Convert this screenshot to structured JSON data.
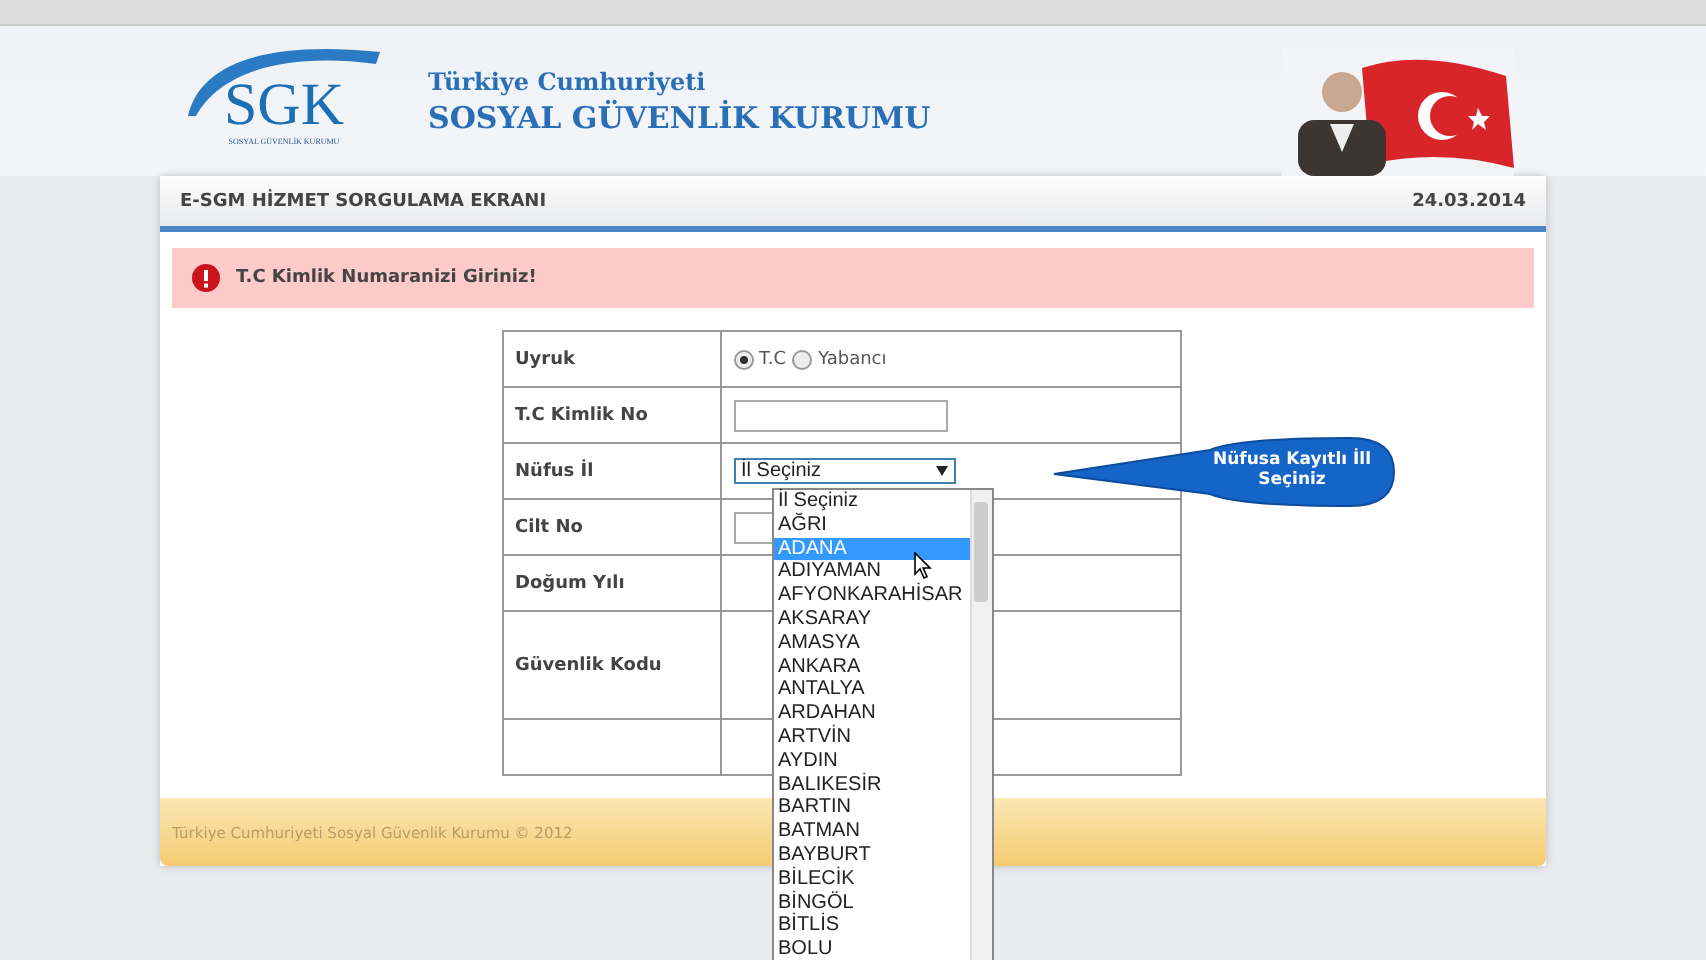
{
  "header": {
    "logo_text": "SGK",
    "logo_subtext": "SOSYAL GÜVENLİK KURUMU",
    "title_line1": "Türkiye Cumhuriyeti",
    "title_line2": "SOSYAL GÜVENLİK KURUMU"
  },
  "subheader": {
    "title": "E-SGM HİZMET SORGULAMA EKRANI",
    "date": "24.03.2014"
  },
  "alert": {
    "message": "T.C Kimlik Numaranizi Giriniz!"
  },
  "form": {
    "rows": [
      {
        "label": "Uyruk",
        "kind": "radio",
        "options": [
          {
            "label": "T.C",
            "selected": true
          },
          {
            "label": "Yabancı",
            "selected": false
          }
        ]
      },
      {
        "label": "T.C Kimlik No",
        "kind": "input"
      },
      {
        "label": "Nüfus İl",
        "kind": "select",
        "value": "İl Seçiniz",
        "expanded": true
      },
      {
        "label": "Cilt No",
        "kind": "input"
      },
      {
        "label": "Doğum Yılı",
        "kind": "hidden"
      },
      {
        "label": "Güvenlik Kodu",
        "kind": "tall"
      },
      {
        "label": "",
        "kind": "empty"
      }
    ]
  },
  "dropdown": {
    "items": [
      {
        "label": "İl Seçiniz",
        "selected": false
      },
      {
        "label": "AĞRI",
        "selected": false
      },
      {
        "label": "ADANA",
        "selected": true
      },
      {
        "label": "ADIYAMAN",
        "selected": false
      },
      {
        "label": "AFYONKARAHİSAR",
        "selected": false
      },
      {
        "label": "AKSARAY",
        "selected": false
      },
      {
        "label": "AMASYA",
        "selected": false
      },
      {
        "label": "ANKARA",
        "selected": false
      },
      {
        "label": "ANTALYA",
        "selected": false
      },
      {
        "label": "ARDAHAN",
        "selected": false
      },
      {
        "label": "ARTVİN",
        "selected": false
      },
      {
        "label": "AYDIN",
        "selected": false
      },
      {
        "label": "BALIKESİR",
        "selected": false
      },
      {
        "label": "BARTIN",
        "selected": false
      },
      {
        "label": "BATMAN",
        "selected": false
      },
      {
        "label": "BAYBURT",
        "selected": false
      },
      {
        "label": "BİLECİK",
        "selected": false
      },
      {
        "label": "BİNGÖL",
        "selected": false
      },
      {
        "label": "BİTLİS",
        "selected": false
      },
      {
        "label": "BOLU",
        "selected": false
      }
    ]
  },
  "callout": {
    "text": "Nüfusa Kayıtlı İll Seçiniz"
  },
  "footer": {
    "text": "Türkiye Cumhuriyeti Sosyal Güvenlik Kurumu © 2012"
  }
}
